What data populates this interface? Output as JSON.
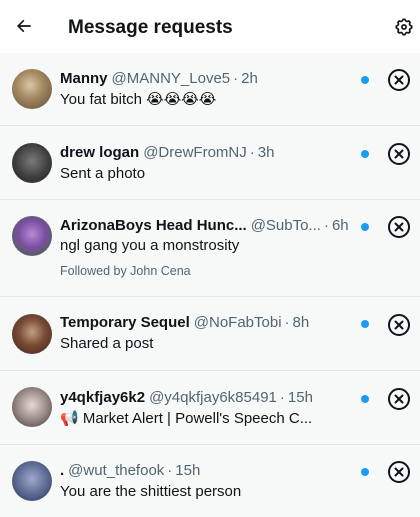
{
  "header": {
    "title": "Message requests",
    "back_icon": "back-arrow-icon",
    "settings_icon": "gear-icon"
  },
  "colors": {
    "unread_dot": "#1d9bf0",
    "row_background": "#f7f9f9",
    "secondary_text": "#536471"
  },
  "requests": [
    {
      "name": "Manny",
      "handle": "@MANNY_Love5",
      "sep": "·",
      "time": "2h",
      "message": "You fat bitch 😭😭😭😭",
      "unread": true
    },
    {
      "name": "drew logan",
      "handle": "@DrewFromNJ",
      "sep": "·",
      "time": "3h",
      "message": "Sent a photo",
      "unread": true
    },
    {
      "name": "ArizonaBoys Head Hunc...",
      "handle": "@SubTo...",
      "sep": "·",
      "time": "6h",
      "message": "ngl gang you a monstrosity",
      "subtext": "Followed by John Cena",
      "unread": true
    },
    {
      "name": "Temporary Sequel",
      "handle": "@NoFabTobi",
      "sep": "·",
      "time": "8h",
      "message": "Shared a post",
      "unread": true
    },
    {
      "name": "y4qkfjay6k2",
      "handle": "@y4qkfjay6k85491",
      "sep": "·",
      "time": "15h",
      "message": "📢 Market Alert | Powell's Speech C...",
      "unread": true
    },
    {
      "name": ".",
      "handle": "@wut_thefook",
      "sep": "·",
      "time": "15h",
      "message": "You are the shittiest person",
      "unread": true
    }
  ]
}
